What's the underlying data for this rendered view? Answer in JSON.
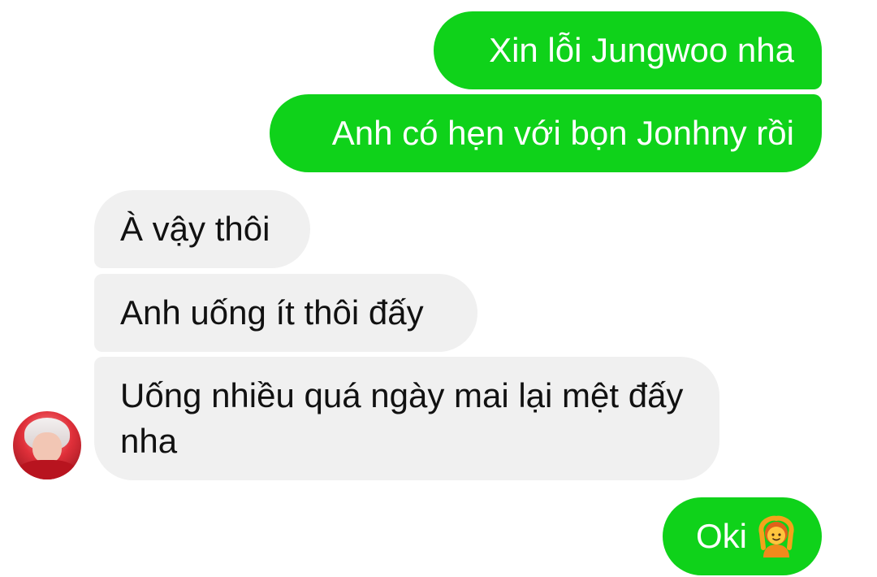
{
  "messages": {
    "out_1": "Xin lỗi Jungwoo nha",
    "out_2": "Anh có hẹn với bọn Jonhny rồi",
    "in_1": "À vậy thôi",
    "in_2": "Anh uống ít thôi đấy",
    "in_3": "Uống nhiều quá ngày mai lại mệt đấy nha",
    "out_3": "Oki"
  },
  "icons": {
    "reaction_emoji": "person-gesturing-ok-icon",
    "contact_avatar": "contact-avatar"
  },
  "colors": {
    "sent_bubble": "#0fd21a",
    "received_bubble": "#f0f0f0"
  }
}
